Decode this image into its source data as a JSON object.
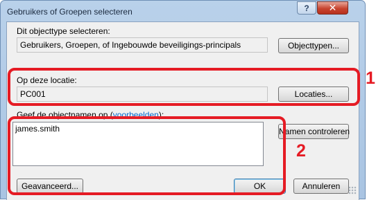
{
  "dialog": {
    "title": "Gebruikers of Groepen selecteren",
    "help_label": "?",
    "close_label": "✕"
  },
  "object_type": {
    "label": "Dit objecttype selecteren:",
    "value": "Gebruikers, Groepen, of Ingebouwde beveiligings-principals",
    "button": "Objecttypen..."
  },
  "location": {
    "label": "Op deze locatie:",
    "value": "PC001",
    "button": "Locaties..."
  },
  "names": {
    "label_prefix": "Geef de objectnamen op (",
    "label_link": "voorbeelden",
    "label_suffix": "):",
    "value": "james.smith",
    "check_button": "Namen controleren"
  },
  "footer": {
    "advanced_button": "Geavanceerd...",
    "ok_button": "OK",
    "cancel_button": "Annuleren"
  },
  "callouts": {
    "one": "1",
    "two": "2"
  },
  "colors": {
    "highlight": "#e51b24",
    "link": "#0066cc"
  }
}
